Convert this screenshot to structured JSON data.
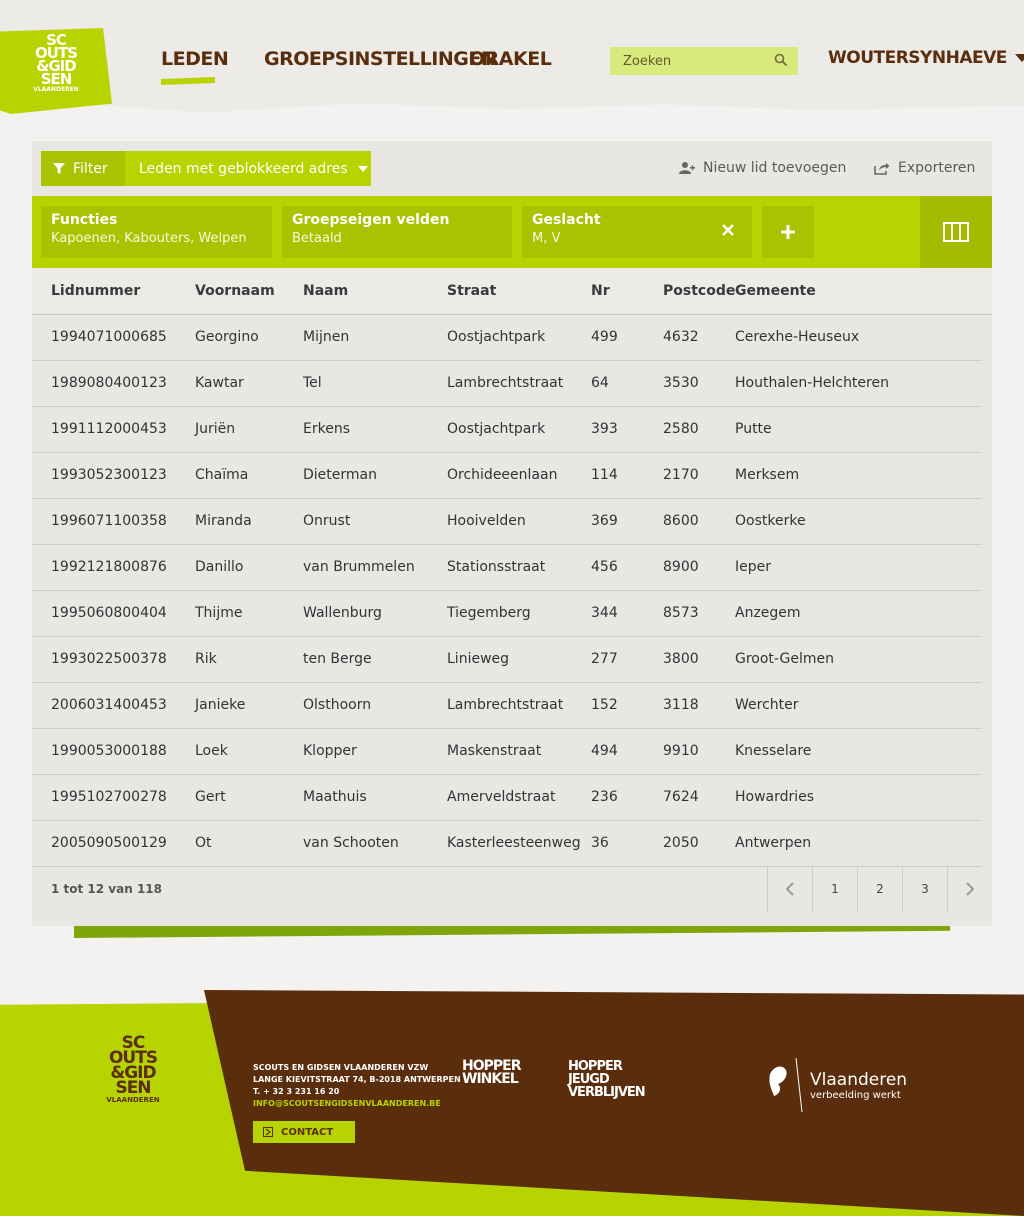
{
  "header": {
    "logo": "SCOUTS & GIDSEN VLAANDEREN",
    "nav": [
      "LEDEN",
      "GROEPSINSTELLINGEN",
      "ORAKEL"
    ],
    "search_placeholder": "Zoeken",
    "user": "WOUTERSYNHAEVE"
  },
  "toolbar": {
    "filter_label": "Filter",
    "filter_value": "Leden met geblokkeerd adres",
    "add_member": "Nieuw lid toevoegen",
    "export": "Exporteren"
  },
  "filters": [
    {
      "title": "Functies",
      "value": "Kapoenen, Kabouters, Welpen"
    },
    {
      "title": "Groepseigen velden",
      "value": "Betaald"
    },
    {
      "title": "Geslacht",
      "value": "M, V"
    }
  ],
  "table": {
    "columns": [
      "Lidnummer",
      "Voornaam",
      "Naam",
      "Straat",
      "Nr",
      "Postcode",
      "Gemeente"
    ],
    "rows": [
      [
        "1994071000685",
        "Georgino",
        "Mijnen",
        "Oostjachtpark",
        "499",
        "4632",
        "Cerexhe-Heuseux"
      ],
      [
        "1989080400123",
        "Kawtar",
        "Tel",
        "Lambrechtstraat",
        "64",
        "3530",
        "Houthalen-Helchteren"
      ],
      [
        "1991112000453",
        "Juriën",
        "Erkens",
        "Oostjachtpark",
        "393",
        "2580",
        "Putte"
      ],
      [
        "1993052300123",
        "Chaïma",
        "Dieterman",
        "Orchideeenlaan",
        "114",
        "2170",
        "Merksem"
      ],
      [
        "1996071100358",
        "Miranda",
        "Onrust",
        "Hooivelden",
        "369",
        "8600",
        "Oostkerke"
      ],
      [
        "1992121800876",
        "Danillo",
        "van Brummelen",
        "Stationsstraat",
        "456",
        "8900",
        "Ieper"
      ],
      [
        "1995060800404",
        "Thijme",
        "Wallenburg",
        "Tiegemberg",
        "344",
        "8573",
        "Anzegem"
      ],
      [
        "1993022500378",
        "Rik",
        "ten Berge",
        "Linieweg",
        "277",
        "3800",
        "Groot-Gelmen"
      ],
      [
        "2006031400453",
        "Janieke",
        "Olsthoorn",
        "Lambrechtstraat",
        "152",
        "3118",
        "Werchter"
      ],
      [
        "1990053000188",
        "Loek",
        "Klopper",
        "Maskenstraat",
        "494",
        "9910",
        "Knesselare"
      ],
      [
        "1995102700278",
        "Gert",
        "Maathuis",
        "Amerveldstraat",
        "236",
        "7624",
        "Howardries"
      ],
      [
        "2005090500129",
        "Ot",
        "van Schooten",
        "Kasterleesteenweg",
        "36",
        "2050",
        "Antwerpen"
      ]
    ]
  },
  "pagination": {
    "summary": "1 tot 12 van 118",
    "pages": [
      "1",
      "2",
      "3"
    ]
  },
  "footer": {
    "org": "SCOUTS EN GIDSEN VLAANDEREN VZW",
    "address": "LANGE KIEVITSTRAAT 74, B-2018 ANTWERPEN",
    "phone": "T. + 32 3 231 16 20",
    "email": "INFO@SCOUTSENGIDSENVLAANDEREN.BE",
    "contact": "CONTACT",
    "brand1": "HOPPER WINKEL",
    "brand2": "HOPPER JEUGD VERBLIJVEN",
    "vl_title": "Vlaanderen",
    "vl_sub": "verbeelding werkt"
  },
  "colors": {
    "accent": "#b7d400",
    "brown": "#5a2d0c"
  }
}
